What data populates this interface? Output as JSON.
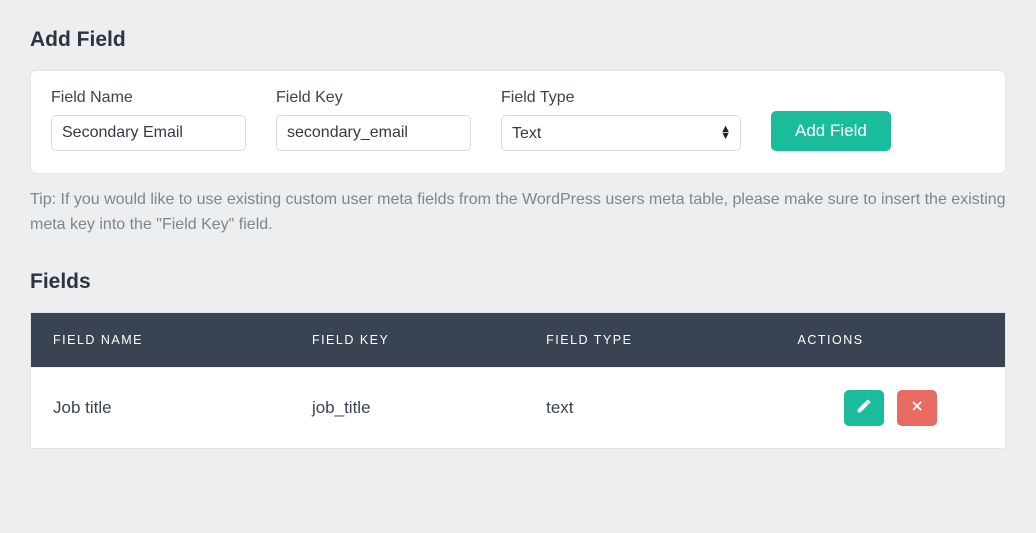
{
  "add_section": {
    "title": "Add Field",
    "field_name_label": "Field Name",
    "field_name_value": "Secondary Email",
    "field_key_label": "Field Key",
    "field_key_value": "secondary_email",
    "field_type_label": "Field Type",
    "field_type_value": "Text",
    "submit_label": "Add Field"
  },
  "tip_text": "Tip: If you would like to use existing custom user meta fields from the WordPress users meta table, please make sure to insert the existing meta key into the \"Field Key\" field.",
  "fields_section": {
    "title": "Fields",
    "columns": {
      "name": "FIELD NAME",
      "key": "FIELD KEY",
      "type": "FIELD TYPE",
      "actions": "ACTIONS"
    },
    "rows": [
      {
        "name": "Job title",
        "key": "job_title",
        "type": "text"
      }
    ]
  }
}
